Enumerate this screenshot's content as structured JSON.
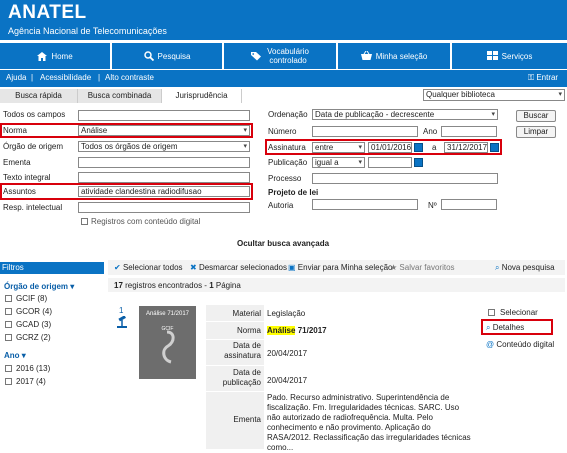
{
  "header": {
    "title": "ANATEL",
    "subtitle": "Agência Nacional de Telecomunicações"
  },
  "nav": [
    {
      "label": "Home",
      "icon": "home-icon"
    },
    {
      "label": "Pesquisa",
      "icon": "search-icon"
    },
    {
      "label": "Vocabulário\ncontrolado",
      "icon": "tags-icon"
    },
    {
      "label": "Minha seleção",
      "icon": "basket-icon"
    },
    {
      "label": "Serviços",
      "icon": "services-icon"
    }
  ],
  "util": {
    "ajuda": "Ajuda",
    "acess": "Acessibilidade",
    "alto": "Alto contraste",
    "entrar": "Entrar"
  },
  "tabs": {
    "rapida": "Busca rápida",
    "combinada": "Busca combinada",
    "juris": "Jurisprudência"
  },
  "library": "Qualquer biblioteca",
  "form": {
    "todos_label": "Todos os campos",
    "norma_label": "Norma",
    "norma_value": "Análise",
    "orgao_label": "Órgão de origem",
    "orgao_value": "Todos os órgãos de origem",
    "ementa_label": "Ementa",
    "texto_label": "Texto integral",
    "assuntos_label": "Assuntos",
    "assuntos_value": "atividade clandestina radiodifusao",
    "resp_label": "Resp. intelectual",
    "digital_label": "Registros com conteúdo digital",
    "ordenacao_label": "Ordenação",
    "ordenacao_value": "Data de publicação - decrescente",
    "numero_label": "Número",
    "ano_label": "Ano",
    "assinatura_label": "Assinatura",
    "assinatura_op": "entre",
    "assinatura_from": "01/01/2016",
    "a_label": "a",
    "assinatura_to": "31/12/2017",
    "publicacao_label": "Publicação",
    "publicacao_op": "igual a",
    "processo_label": "Processo",
    "projeto_label": "Projeto de lei",
    "autoria_label": "Autoria",
    "no_label": "Nº",
    "buscar": "Buscar",
    "limpar": "Limpar",
    "ocultar": "Ocultar busca avançada"
  },
  "filters": {
    "title": "Filtros",
    "orgao_title": "Órgão de origem",
    "orgao_items": [
      "GCIF (8)",
      "GCOR (4)",
      "GCAD (3)",
      "GCRZ (2)"
    ],
    "ano_title": "Ano",
    "ano_items": [
      "2016 (13)",
      "2017 (4)"
    ]
  },
  "toolbar": {
    "sel_todos": "Selecionar todos",
    "desmarcar": "Desmarcar selecionados",
    "enviar": "Enviar para Minha seleção",
    "salvar": "Salvar favoritos",
    "nova": "Nova pesquisa"
  },
  "results": {
    "count": "17",
    "count_text": "registros encontrados -",
    "pages": "1",
    "pages_text": "Página"
  },
  "record": {
    "number": "1",
    "thumb_title": "Análise 71/2017",
    "thumb_sub": "GCIF",
    "material_label": "Material",
    "material_value": "Legislação",
    "norma_label": "Norma",
    "norma_value_hl": "Análise",
    "norma_value_rest": " 71/2017",
    "assinatura_label": "Data de assinatura",
    "assinatura_value": "20/04/2017",
    "publicacao_label": "Data de publicação",
    "publicacao_value": "20/04/2017",
    "ementa_label": "Ementa",
    "ementa_value": "Pado. Recurso administrativo. Superintendência de fiscalização. Fm. Irregularidades técnicas. SARC. Uso não autorizado de radiofrequência. Multa. Pelo conhecimento e não provimento. Aplicação do RASA/2012. Reclassificação das irregularidades técnicas como..."
  },
  "side_actions": {
    "selecionar": "Selecionar",
    "detalhes": "Detalhes",
    "conteudo": "Conteúdo digital"
  }
}
